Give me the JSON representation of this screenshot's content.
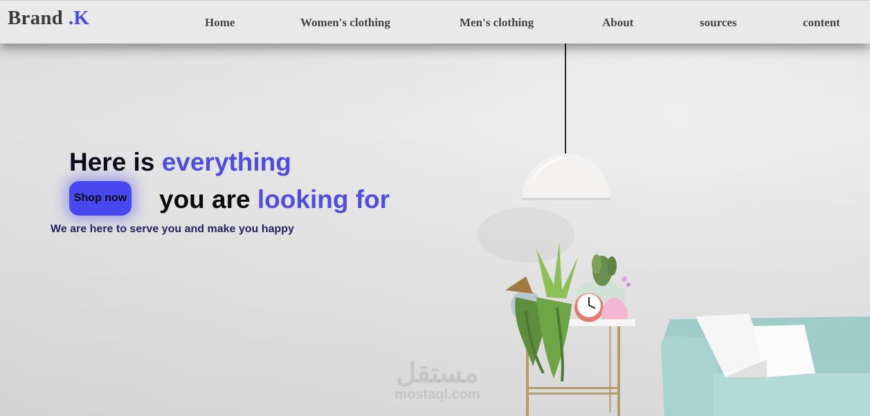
{
  "brand": {
    "name": "Brand",
    "accent": ".K"
  },
  "nav": {
    "items": [
      {
        "label": "Home"
      },
      {
        "label": "Women's clothing"
      },
      {
        "label": "Men's clothing"
      },
      {
        "label": "About"
      },
      {
        "label": "sources"
      },
      {
        "label": "content"
      }
    ]
  },
  "hero": {
    "line1_prefix": "Here is",
    "line1_accent": "everything",
    "line2_prefix": "you are",
    "line2_accent": "looking for",
    "cta_label": "Shop now",
    "subtitle": "We are here to serve you and make you happy"
  },
  "watermark": {
    "arabic": "مستقل",
    "latin": "mostaql.com"
  },
  "colors": {
    "accent": "#4d4ee0",
    "button": "#4848ee",
    "nav_bg": "#e9e9e9",
    "sofa": "#a9d3d1"
  }
}
